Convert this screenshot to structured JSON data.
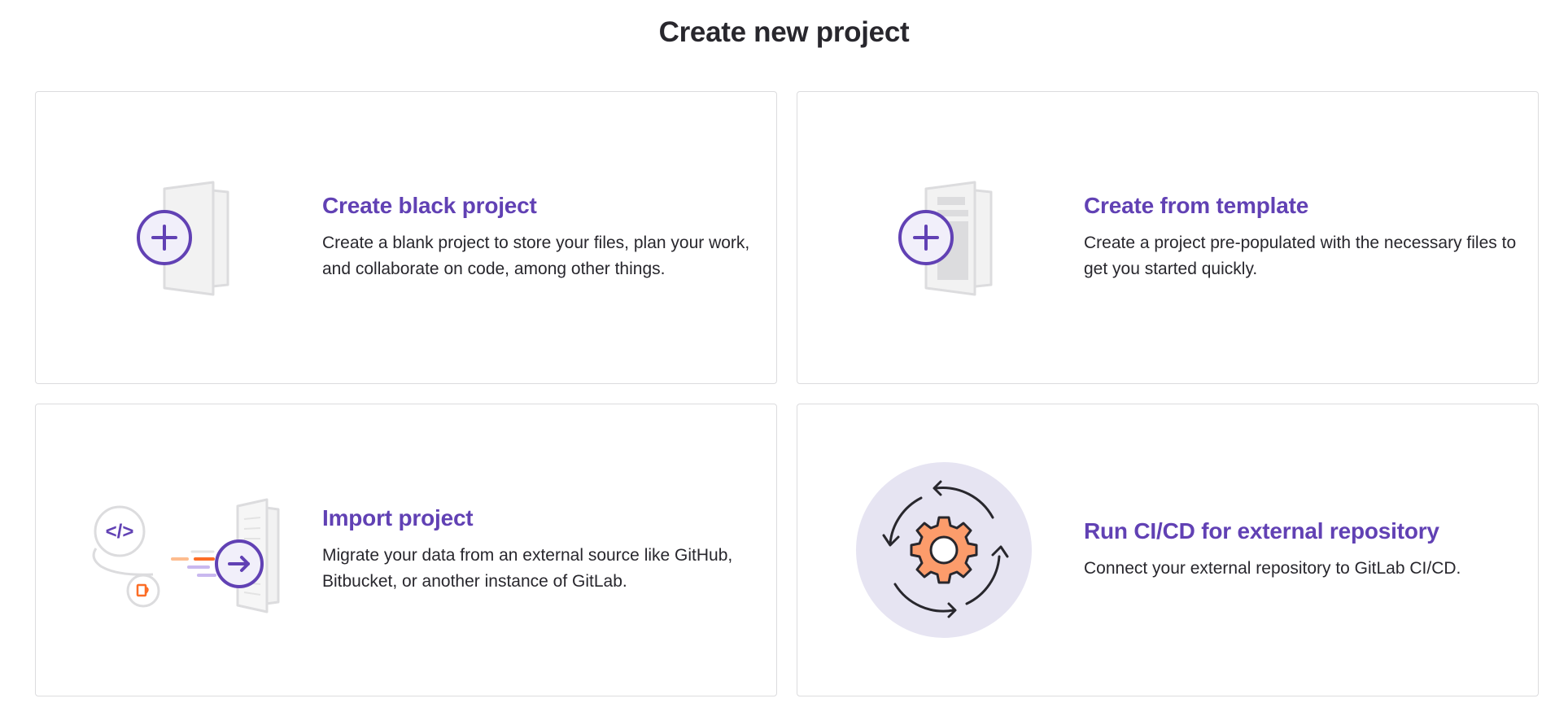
{
  "page": {
    "title": "Create new project"
  },
  "colors": {
    "accent": "#6141b4",
    "text": "#28272d",
    "border": "#dcdcde",
    "orange": "#fc9c6b",
    "circle_bg": "#e6e4f2"
  },
  "cards": [
    {
      "title": "Create black project",
      "description": "Create a blank project to store your files, plan your work, and collaborate on code, among other things.",
      "icon": "blank-project-icon"
    },
    {
      "title": "Create from template",
      "description": "Create a project pre-populated with the necessary files to get you started quickly.",
      "icon": "template-project-icon"
    },
    {
      "title": "Import project",
      "description": "Migrate your data from an external source like GitHub, Bitbucket, or another instance of GitLab.",
      "icon": "import-project-icon"
    },
    {
      "title": "Run CI/CD for external repository",
      "description": "Connect your external repository to GitLab CI/CD.",
      "icon": "cicd-gear-icon"
    }
  ]
}
